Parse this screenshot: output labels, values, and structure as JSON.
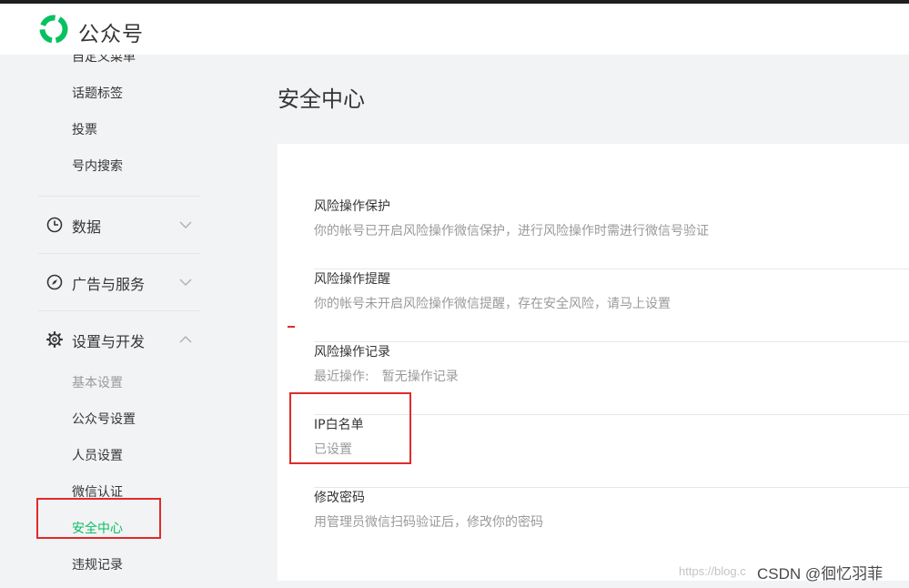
{
  "header": {
    "brand": "公众号"
  },
  "sidebar": {
    "partial_item": "自定义菜单",
    "sub_items_top": [
      "话题标签",
      "投票",
      "号内搜索"
    ],
    "menus": [
      {
        "label": "数据",
        "icon": "clock-icon",
        "expanded": false
      },
      {
        "label": "广告与服务",
        "icon": "compass-icon",
        "expanded": false
      },
      {
        "label": "设置与开发",
        "icon": "gear-icon",
        "expanded": true
      }
    ],
    "settings_items": [
      "基本设置",
      "公众号设置",
      "人员设置",
      "微信认证",
      "安全中心",
      "违规记录"
    ],
    "active_item": "安全中心"
  },
  "main": {
    "title": "安全中心",
    "rows": [
      {
        "title": "风险操作保护",
        "desc": "你的帐号已开启风险操作微信保护，进行风险操作时需进行微信号验证"
      },
      {
        "title": "风险操作提醒",
        "desc": "你的帐号未开启风险操作微信提醒，存在安全风险，请马上设置"
      },
      {
        "title": "风险操作记录",
        "desc_label": "最近操作:",
        "desc_value": "暂无操作记录"
      },
      {
        "title": "IP白名单",
        "desc": "已设置"
      },
      {
        "title": "修改密码",
        "desc": "用管理员微信扫码验证后，修改你的密码"
      }
    ]
  },
  "watermark": {
    "url": "https://blog.c",
    "text": "CSDN @徊忆羽菲"
  },
  "colors": {
    "accent": "#07c160",
    "annotation": "#e02b2b",
    "background": "#f2f3f5"
  }
}
